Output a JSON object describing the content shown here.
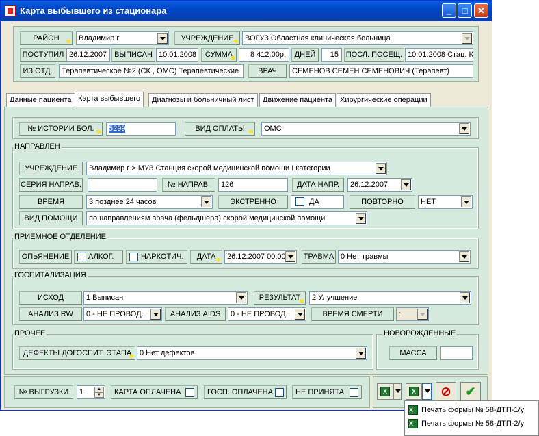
{
  "window": {
    "title": "Карта выбывшего из стационара",
    "min": "_",
    "max": "□",
    "close": "✕"
  },
  "header": {
    "raion_label": "РАЙОН",
    "raion_value": "Владимир г",
    "uchr_label": "УЧРЕЖДЕНИЕ",
    "uchr_value": "ВОГУЗ Областная клиническая больница",
    "postupil_label": "ПОСТУПИЛ",
    "postupil_value": "26.12.2007",
    "vypisan_label": "ВЫПИСАН",
    "vypisan_value": "10.01.2008",
    "summa_label": "СУММА",
    "summa_value": "8 412,00р.",
    "dney_label": "ДНЕЙ",
    "dney_value": "15",
    "posl_label": "ПОСЛ. ПОСЕЩ.",
    "posl_value": "10.01.2008 Стац. К",
    "izotd_label": "ИЗ ОТД.",
    "izotd_value": "Терапевтическое №2 (СК , ОМС) Терапевтические",
    "vrach_label": "ВРАЧ",
    "vrach_value": "СЕМЕНОВ СЕМЕН СЕМЕНОВИЧ (Терапевт)"
  },
  "tabs": [
    "Данные пациента",
    "Карта выбывшего",
    "Диагнозы и больничный лист",
    "Движение пациента",
    "Хирургические операции"
  ],
  "card": {
    "nib_label": "№ ИСТОРИИ БОЛ.",
    "nib_value": "5299",
    "vidopl_label": "ВИД ОПЛАТЫ",
    "vidopl_value": "ОМС",
    "napravlen": {
      "title": "НАПРАВЛЕН",
      "uchr_label": "УЧРЕЖДЕНИЕ",
      "uchr_value": "Владимир г > МУЗ Станция скорой медицинской помощи I категории",
      "seria_label": "СЕРИЯ НАПРАВ.",
      "seria_value": "",
      "nom_label": "№ НАПРАВ.",
      "nom_value": "126",
      "data_label": "ДАТА НАПР.",
      "data_value": "26.12.2007",
      "vremya_label": "ВРЕМЯ",
      "vremya_value": "3  позднее 24 часов",
      "ekstr_label": "ЭКСТРЕННО",
      "da_label": "ДА",
      "povt_label": "ПОВТОРНО",
      "povt_value": "НЕТ",
      "vidpom_label": "ВИД ПОМОЩИ",
      "vidpom_value": "по направлениям врача (фельдшера) скорой медицинской помощи"
    },
    "priem": {
      "title": "ПРИЕМНОЕ ОТДЕЛЕНИЕ",
      "opyan_label": "ОПЬЯНЕНИЕ",
      "alk_label": "АЛКОГ.",
      "nark_label": "НАРКОТИЧ.",
      "data_label": "ДАТА",
      "data_value": "26.12.2007 00:00",
      "travma_label": "ТРАВМА",
      "travma_value": "0  Нет травмы"
    },
    "gosp": {
      "title": "ГОСПИТАЛИЗАЦИЯ",
      "ishod_label": "ИСХОД",
      "ishod_value": "1  Выписан",
      "rez_label": "РЕЗУЛЬТАТ",
      "rez_value": "2  Улучшение",
      "rw_label": "АНАЛИЗ RW",
      "rw_value": "0 - НЕ ПРОВОД.",
      "aids_label": "АНАЛИЗ AIDS",
      "aids_value": "0 - НЕ ПРОВОД.",
      "vs_label": "ВРЕМЯ СМЕРТИ",
      "vs_value": ":"
    },
    "prochee": {
      "title": "ПРОЧЕЕ",
      "def_label": "ДЕФЕКТЫ ДОГОСПИТ. ЭТАПА",
      "def_value": "0  Нет дефектов"
    },
    "novor": {
      "title": "НОВОРОЖДЕННЫЕ",
      "massa_label": "МАССА",
      "massa_value": ""
    }
  },
  "footer": {
    "vygr_label": "№ ВЫГРУЗКИ",
    "vygr_value": "1",
    "karta_label": "КАРТА ОПЛАЧЕНА",
    "gosp_label": "ГОСП. ОПЛАЧЕНА",
    "nepr_label": "НЕ ПРИНЯТА"
  },
  "menu": [
    "Печать формы № 58-ДТП-1/у",
    "Печать формы № 58-ДТП-2/у"
  ],
  "icons": {
    "excel": "X",
    "cancel": "⊘",
    "ok": "✔"
  }
}
